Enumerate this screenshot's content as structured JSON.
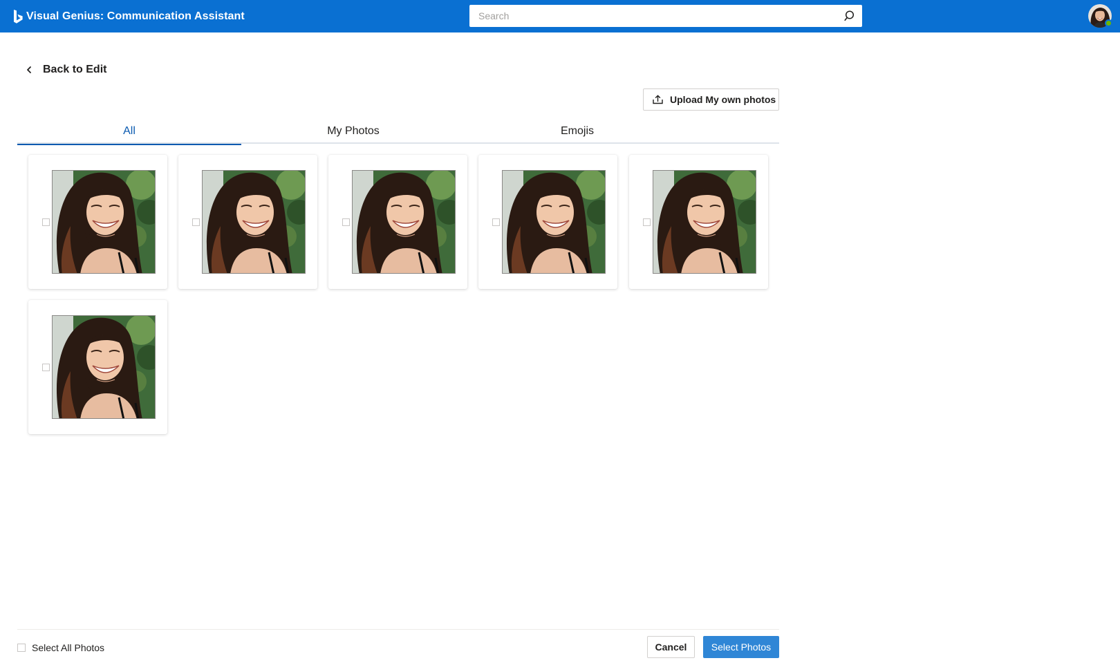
{
  "app": {
    "title": "Visual Genius: Communication Assistant",
    "logo_icon": "bing-logo-icon",
    "brand_color": "#0a70d2"
  },
  "search": {
    "placeholder": "Search",
    "value": "",
    "icon": "search-icon"
  },
  "user": {
    "avatar_icon": "user-avatar",
    "presence": "available",
    "presence_color": "#6bb700"
  },
  "nav": {
    "back_label": "Back to Edit",
    "back_icon": "chevron-left-icon"
  },
  "toolbar": {
    "upload_label": "Upload My own photos",
    "upload_icon": "upload-icon"
  },
  "tabs": [
    {
      "label": "All",
      "active": true
    },
    {
      "label": "My Photos",
      "active": false
    },
    {
      "label": "Emojis",
      "active": false
    }
  ],
  "photos": [
    {
      "selected": false
    },
    {
      "selected": false
    },
    {
      "selected": false
    },
    {
      "selected": false
    },
    {
      "selected": false
    },
    {
      "selected": false
    }
  ],
  "footer": {
    "select_all_label": "Select All Photos",
    "select_all_checked": false,
    "cancel_label": "Cancel",
    "select_label": "Select Photos"
  },
  "colors": {
    "active_tab": "#0a5ab0",
    "primary_button": "#2f86d6"
  }
}
